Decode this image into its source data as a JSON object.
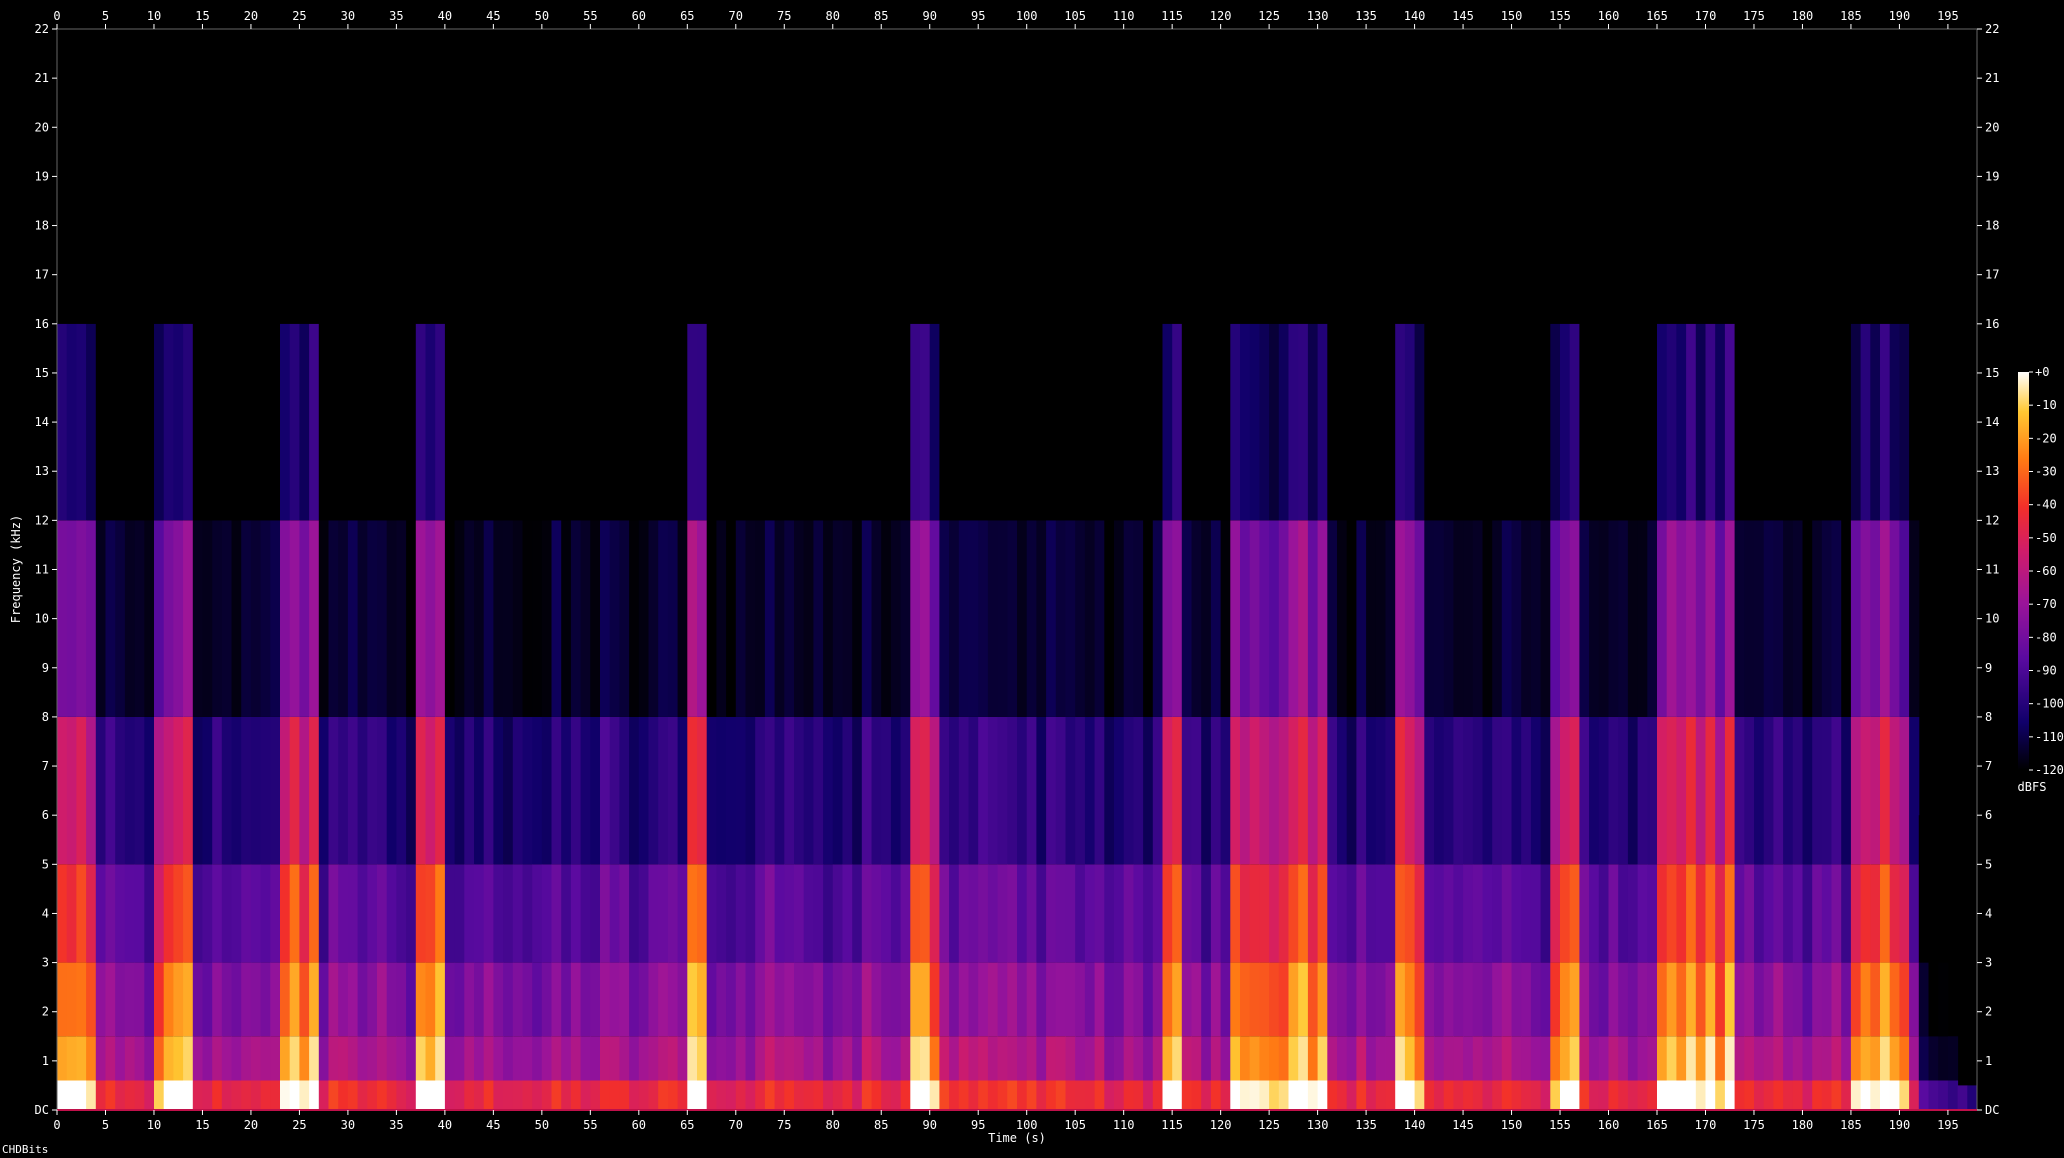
{
  "chart_data": {
    "type": "heatmap",
    "subtype": "spectrogram",
    "xlabel": "Time (s)",
    "ylabel": "Frequency (kHz)",
    "xlim": [
      0,
      198
    ],
    "ylim": [
      0,
      22
    ],
    "x_ticks": [
      "0",
      "5",
      "10",
      "15",
      "20",
      "25",
      "30",
      "35",
      "40",
      "45",
      "50",
      "55",
      "60",
      "65",
      "70",
      "75",
      "80",
      "85",
      "90",
      "95",
      "100",
      "105",
      "110",
      "115",
      "120",
      "125",
      "130",
      "135",
      "140",
      "145",
      "150",
      "155",
      "160",
      "165",
      "170",
      "175",
      "180",
      "185",
      "190",
      "195"
    ],
    "y_ticks": [
      "DC",
      "1",
      "2",
      "3",
      "4",
      "5",
      "6",
      "7",
      "8",
      "9",
      "10",
      "11",
      "12",
      "13",
      "14",
      "15",
      "16",
      "17",
      "18",
      "19",
      "20",
      "21",
      "22"
    ],
    "colorbar": {
      "label": "dBFS",
      "ticks": [
        "+0",
        "-10",
        "-20",
        "-30",
        "-40",
        "-50",
        "-60",
        "-70",
        "-80",
        "-90",
        "-100",
        "-110",
        "-120"
      ],
      "range": [
        -120,
        0
      ],
      "colors": [
        "#000000",
        "#10006a",
        "#5a0aa0",
        "#9a149a",
        "#d01c6a",
        "#f22f2a",
        "#ff7a14",
        "#ffc832",
        "#ffffff"
      ]
    },
    "music_end_time": 192,
    "loud_segments": [
      [
        0,
        4
      ],
      [
        10,
        14
      ],
      [
        23,
        27
      ],
      [
        37,
        40
      ],
      [
        65,
        67
      ],
      [
        88,
        91
      ],
      [
        114,
        116
      ],
      [
        121,
        131
      ],
      [
        138,
        141
      ],
      [
        154,
        157
      ],
      [
        165,
        173
      ],
      [
        185,
        191
      ]
    ]
  },
  "footer": {
    "watermark": "CHDBits"
  }
}
